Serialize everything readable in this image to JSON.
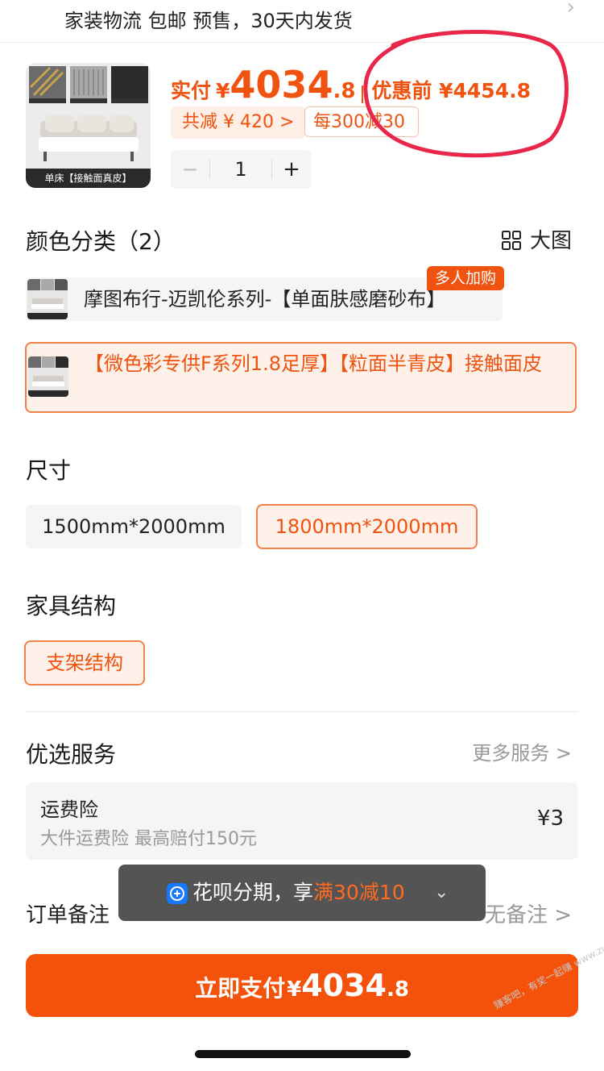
{
  "shipping": {
    "text": "家装物流 包邮 预售，30天内发货"
  },
  "product": {
    "thumb_caption": "单床【接触面真皮】",
    "pay_label": "实付",
    "currency": "¥",
    "pay_int": "4034",
    "pay_dec": ".8",
    "original_price": "优惠前 ¥4454.8",
    "saved_chip": "共减 ¥ 420 >",
    "promo_chip": "每300减30",
    "quantity": "1",
    "minus": "−",
    "plus": "+"
  },
  "color_section": {
    "title": "颜色分类（2）",
    "bigview_label": "大图",
    "group_tag": "多人加购",
    "options": [
      {
        "label": "摩图布行-迈凯伦系列-【单面肤感磨砂布】"
      },
      {
        "label": "【微色彩专供F系列1.8足厚】【粒面半青皮】接触面皮"
      }
    ]
  },
  "size_section": {
    "title": "尺寸",
    "options": [
      {
        "label": "1500mm*2000mm"
      },
      {
        "label": "1800mm*2000mm"
      }
    ]
  },
  "structure_section": {
    "title": "家具结构",
    "options": [
      {
        "label": "支架结构"
      }
    ]
  },
  "services": {
    "title": "优选服务",
    "more": "更多服务 >",
    "insurance": {
      "title": "运费险",
      "desc": "大件运费险 最高赔付150元",
      "price": "¥3"
    }
  },
  "note": {
    "label": "订单备注",
    "value": "无备注 >"
  },
  "toast": {
    "prefix": "花呗分期，享",
    "highlight": "满30减10",
    "chevron": "⌄"
  },
  "pay_button": {
    "label": "立即支付",
    "currency": "¥",
    "int": "4034",
    "dec": ".8"
  },
  "watermark": "赚客吧，有奖一起赚 www.zuanke8.com",
  "colors": {
    "accent": "#f0520f",
    "button": "#f4510b",
    "circle": "#e8274b"
  }
}
